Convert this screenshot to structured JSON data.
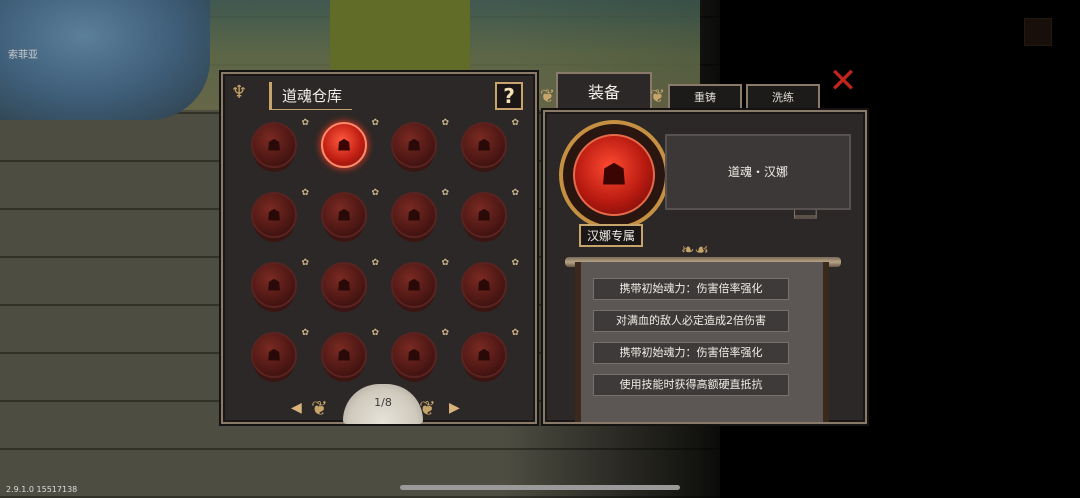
{
  "background": {
    "location_label": "索菲亚",
    "version": "2.9.1.0 15517138"
  },
  "storage": {
    "title": "道魂仓库",
    "help_label": "?",
    "orbs": [
      {
        "active": false
      },
      {
        "active": true
      },
      {
        "active": false
      },
      {
        "active": false
      },
      {
        "active": false
      },
      {
        "active": false
      },
      {
        "active": false
      },
      {
        "active": false
      },
      {
        "active": false
      },
      {
        "active": false
      },
      {
        "active": false
      },
      {
        "active": false
      },
      {
        "active": false
      },
      {
        "active": false
      },
      {
        "active": false
      },
      {
        "active": false
      }
    ],
    "page_indicator": "1/8",
    "prev_arrow": "◀",
    "next_arrow": "▶"
  },
  "tabs": {
    "equip": "装备",
    "recast": "重铸",
    "reroll": "洗练"
  },
  "detail": {
    "name": "道魂・汉娜",
    "exclusive_label": "汉娜专属",
    "traits": [
      "携带初始魂力：伤害倍率强化",
      "对满血的敌人必定造成2倍伤害",
      "携带初始魂力：伤害倍率强化",
      "使用技能时获得高额硬直抵抗"
    ]
  },
  "colors": {
    "accent_gold": "#c7a46a",
    "active_red": "#ff3a20",
    "close_red": "#c2241e",
    "panel_bg": "#2b2827"
  },
  "icons": {
    "close": "close-pinwheel-icon",
    "help": "question-icon",
    "orb": "soul-orb-icon"
  }
}
